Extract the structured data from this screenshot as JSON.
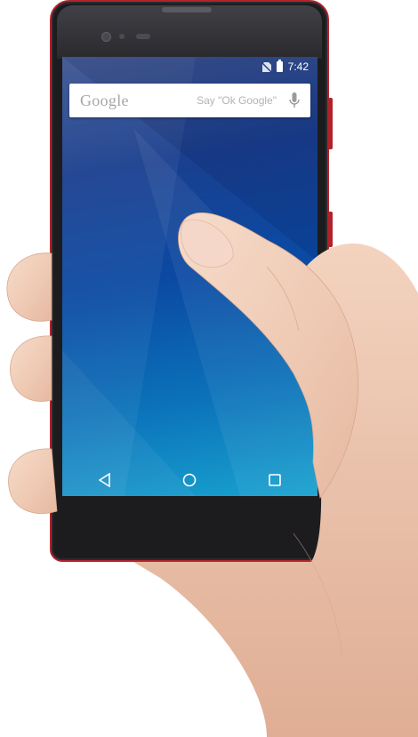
{
  "status_bar": {
    "time": "7:42",
    "sim_icon": "no-sim-icon",
    "battery_icon": "battery-full-icon"
  },
  "search": {
    "logo": "Google",
    "hint": "Say \"Ok Google\"",
    "mic_icon": "mic-icon"
  },
  "nav": {
    "back_icon": "back-triangle-icon",
    "home_icon": "home-circle-icon",
    "recents_icon": "recents-square-icon"
  },
  "colors": {
    "frame_accent": "#b2232c",
    "wallpaper_top": "#3e5692",
    "wallpaper_bottom": "#18a2cf"
  }
}
